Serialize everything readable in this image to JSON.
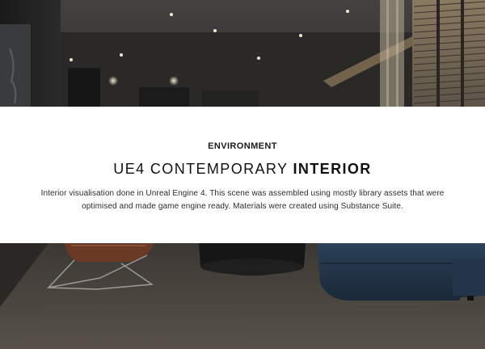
{
  "card": {
    "eyebrow": "ENVIRONMENT",
    "title_prefix": "UE4 CONTEMPORARY",
    "title_emphasis": "INTERIOR",
    "description": "Interior visualisation done in Unreal Engine 4. This scene was assembled using mostly library assets that were optimised and made game engine ready. Materials were created using Substance Suite."
  },
  "colors": {
    "card_background": "#ffffff",
    "heading_text": "#111111",
    "body_text": "#2c2c2c",
    "sofa_blue": "#24364a",
    "chair_leather": "#6a3a25",
    "floor_carpet": "#4f4942",
    "ceiling": "#3d3c3a"
  }
}
